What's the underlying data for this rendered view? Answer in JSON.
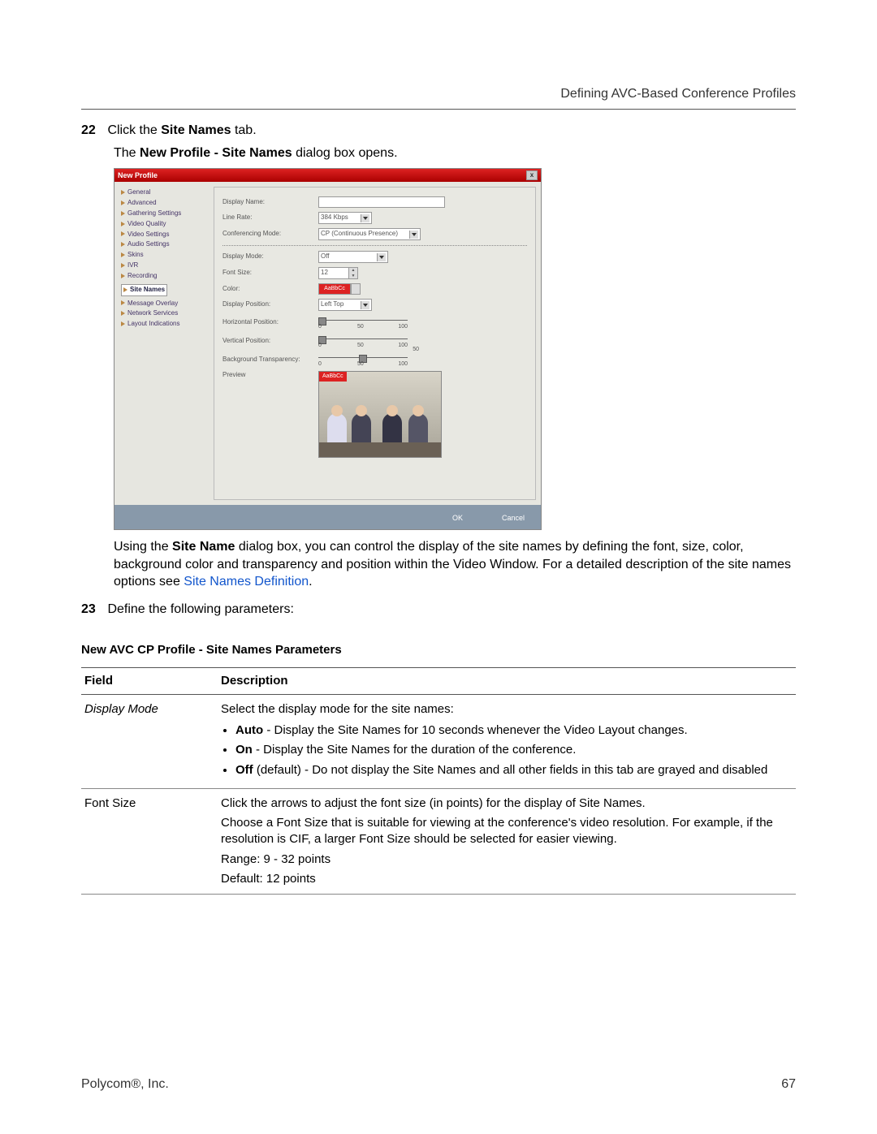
{
  "header": "Defining AVC-Based Conference Profiles",
  "step22_num": "22",
  "step22_pre": " Click the ",
  "step22_bold": "Site Names",
  "step22_post": " tab.",
  "step22_sub_pre": "The ",
  "step22_sub_bold": "New Profile - Site Names",
  "step22_sub_post": " dialog box opens.",
  "dialog": {
    "title": "New Profile",
    "close": "x",
    "sidebar": [
      "General",
      "Advanced",
      "Gathering Settings",
      "Video Quality",
      "Video Settings",
      "Audio Settings",
      "Skins",
      "IVR",
      "Recording",
      "Site Names",
      "Message Overlay",
      "Network Services",
      "Layout Indications"
    ],
    "labels": {
      "display_name": "Display Name:",
      "line_rate": "Line Rate:",
      "conf_mode": "Conferencing Mode:",
      "display_mode": "Display Mode:",
      "font_size": "Font Size:",
      "color": "Color:",
      "display_pos": "Display Position:",
      "h_pos": "Horizontal Position:",
      "v_pos": "Vertical Position:",
      "bg_trans": "Background Transparency:",
      "preview": "Preview"
    },
    "vals": {
      "line_rate": "384 Kbps",
      "conf_mode": "CP (Continuous Presence)",
      "display_mode": "Off",
      "font_size": "12",
      "color_sample": "AaBbCc",
      "display_pos": "Left Top",
      "slider_0": "0",
      "slider_50": "50",
      "slider_100": "100",
      "bg_val": "50",
      "preview_tag": "AaBbCc"
    },
    "buttons": {
      "ok": "OK",
      "cancel": "Cancel"
    }
  },
  "para_using_pre": "Using the ",
  "para_using_bold": "Site Name",
  "para_using_mid": " dialog box, you can control the display of the site names by defining the font, size, color, background color and transparency and position within the Video Window. For a detailed description of the site names options see ",
  "para_using_link": "Site Names Definition",
  "para_using_post": ".",
  "step23_num": "23",
  "step23_text": " Define the following parameters:",
  "table_caption": "New AVC CP Profile - Site Names Parameters",
  "th_field": "Field",
  "th_desc": "Description",
  "row1": {
    "field": "Display Mode",
    "desc_intro": "Select the display mode for the site names:",
    "b1_b": "Auto",
    "b1_t": " - Display the Site Names for 10 seconds whenever the Video Layout changes.",
    "b2_b": "On",
    "b2_t": " - Display the Site Names for the duration of the conference.",
    "b3_b": "Off",
    "b3_t": " (default) - Do not display the Site Names and all other fields in this tab are grayed and disabled"
  },
  "row2": {
    "field": "Font Size",
    "p1": "Click the arrows to adjust the font size (in points) for the display of Site Names.",
    "p2": "Choose a Font Size that is suitable for viewing at the conference's video resolution. For example, if the resolution is CIF, a larger Font Size should be selected for easier viewing.",
    "p3": "Range: 9 - 32 points",
    "p4": "Default: 12 points"
  },
  "footer_left": "Polycom®, Inc.",
  "footer_right": "67"
}
